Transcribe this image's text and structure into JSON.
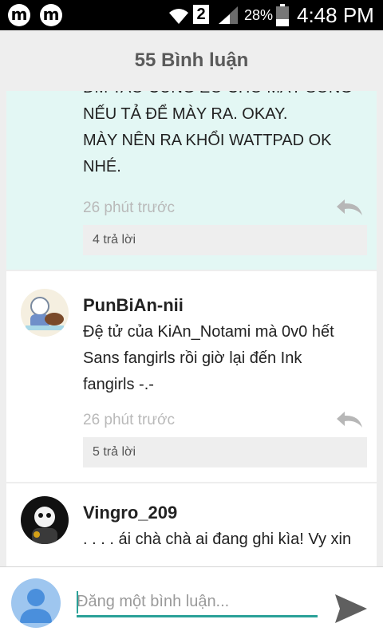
{
  "status_bar": {
    "app1": "m",
    "app2": "m",
    "sim": "2",
    "battery_pct": "28%",
    "time": "4:48 PM"
  },
  "header": {
    "title": "55 Bình luận"
  },
  "comments": [
    {
      "username": "",
      "lines": [
        "ĐM TAO CŨNG EO CHO MÀY SỐNG",
        "NẾU TẢ ĐỂ MÀY RA. OKAY.",
        "MÀY NÊN RA KHỔI WATTPAD OK",
        "NHÉ."
      ],
      "time": "26 phút trước",
      "replies": "4 trả lời"
    },
    {
      "username": "PunBiAn-nii",
      "lines": [
        "Đệ tử của KiAn_Notami mà 0v0 hết",
        "Sans fangirls rồi giờ lại đến Ink",
        "fangirls -.-"
      ],
      "time": "26 phút trước",
      "replies": "5 trả lời"
    },
    {
      "username": "Vingro_209",
      "lines": [
        ". . . . ái chà chà ai đang ghi kìa! Vy xin"
      ]
    }
  ],
  "composer": {
    "placeholder": "Đăng một bình luận..."
  },
  "colors": {
    "accent": "#2aa198",
    "highlight_bg": "#e3f7f4"
  }
}
